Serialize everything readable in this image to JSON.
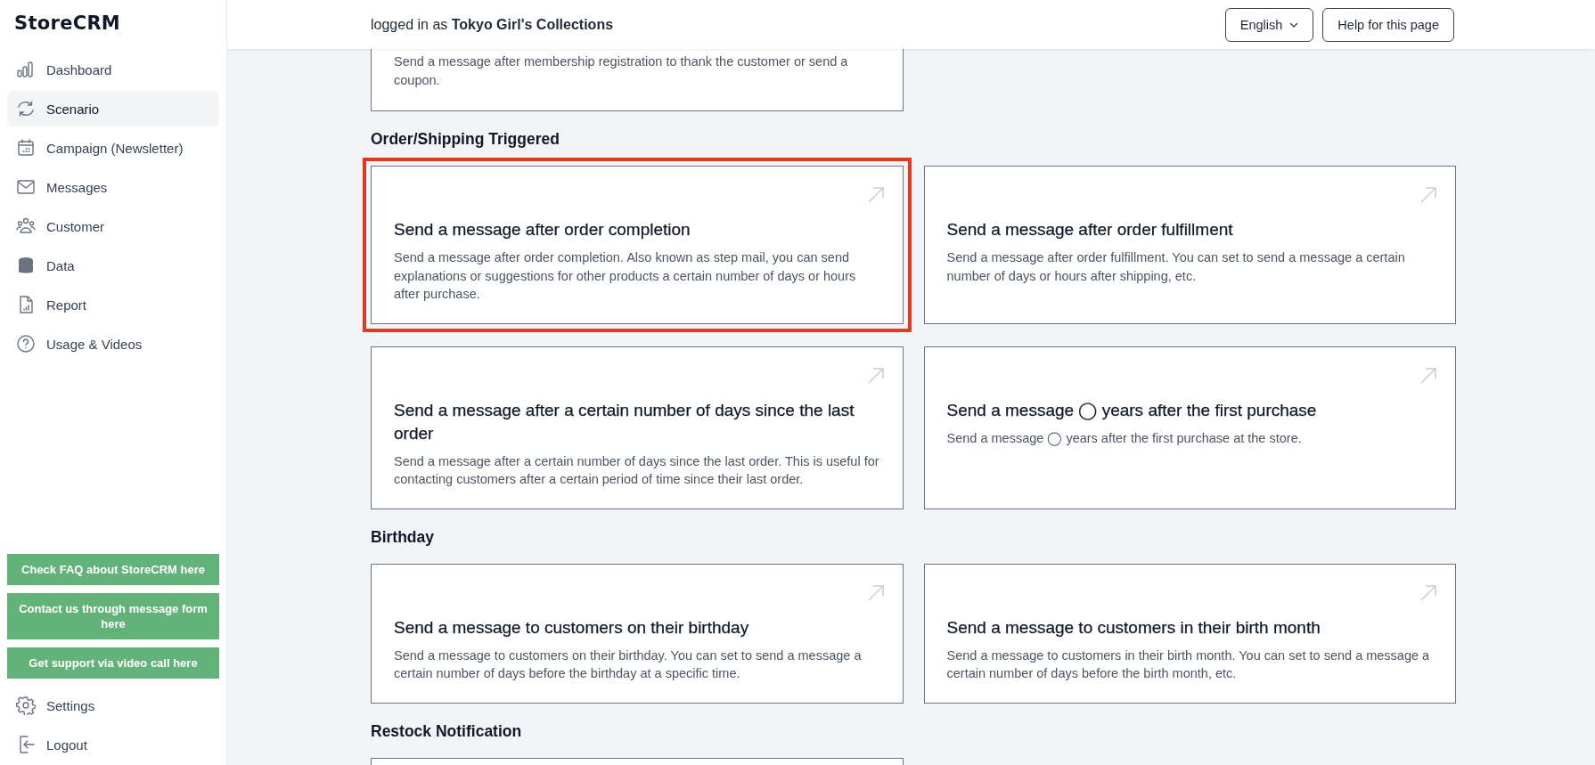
{
  "sidebar": {
    "logo": "StoreCRM",
    "items": [
      {
        "label": "Dashboard",
        "selected": false
      },
      {
        "label": "Scenario",
        "selected": true
      },
      {
        "label": "Campaign (Newsletter)",
        "selected": false
      },
      {
        "label": "Messages",
        "selected": false
      },
      {
        "label": "Customer",
        "selected": false
      },
      {
        "label": "Data",
        "selected": false
      },
      {
        "label": "Report",
        "selected": false
      },
      {
        "label": "Usage & Videos",
        "selected": false
      }
    ],
    "support_links": [
      "Check FAQ about StoreCRM here",
      "Contact us through message form here",
      "Get support via video call here"
    ],
    "bottom_items": [
      {
        "label": "Settings"
      },
      {
        "label": "Logout"
      }
    ]
  },
  "header": {
    "login_text": "logged in as **Tokyo Girl's Collections**",
    "language": "English",
    "help_button": "Help for this page"
  },
  "sections": [
    {
      "cards": [
        {
          "kind": "tail",
          "description": "Send a message after membership registration to thank the customer or send a coupon."
        }
      ]
    },
    {
      "heading": "Order/Shipping Triggered",
      "cards": [
        {
          "kind": "full",
          "title": "Send a message after order completion",
          "description": "Send a message after order completion. Also known as step mail, you can send explanations or suggestions for other products a certain number of days or hours after purchase.",
          "highlighted": true
        },
        {
          "kind": "full",
          "title": "Send a message after order fulfillment",
          "description": "Send a message after order fulfillment. You can set to send a message a certain number of days or hours after shipping, etc.",
          "highlighted": false
        },
        {
          "kind": "full",
          "title": "Send a message after a certain number of days since the last order",
          "description": "Send a message after a certain number of days since the last order. This is useful for contacting customers after a certain period of time since their last order.",
          "highlighted": false
        },
        {
          "kind": "full",
          "title": "Send a message ◯ years after the first purchase",
          "description": "Send a message ◯ years after the first purchase at the store.",
          "highlighted": false
        }
      ]
    },
    {
      "heading": "Birthday",
      "cards": [
        {
          "kind": "full",
          "title": "Send a message to customers on their birthday",
          "description": "Send a message to customers on their birthday. You can set to send a message a certain number of days before the birthday at a specific time.",
          "highlighted": false
        },
        {
          "kind": "full",
          "title": "Send a message to customers in their birth month",
          "description": "Send a message to customers in their birth month. You can set to send a message a certain number of days before the birth month, etc.",
          "highlighted": false
        }
      ]
    },
    {
      "heading": "Restock Notification",
      "cards": [
        {
          "kind": "edge"
        }
      ]
    }
  ]
}
